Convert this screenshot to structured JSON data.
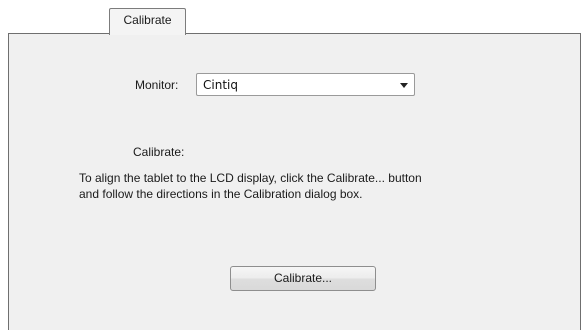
{
  "tabs": [
    {
      "label": "Calibrate"
    }
  ],
  "monitor": {
    "label": "Monitor:",
    "selected": "Cintiq"
  },
  "calibrate_section": {
    "label": "Calibrate:",
    "instructions_line1": "To align the tablet to the LCD display, click the Calibrate... button",
    "instructions_line2": "and follow the directions in the Calibration dialog box."
  },
  "actions": {
    "calibrate_button": "Calibrate..."
  }
}
